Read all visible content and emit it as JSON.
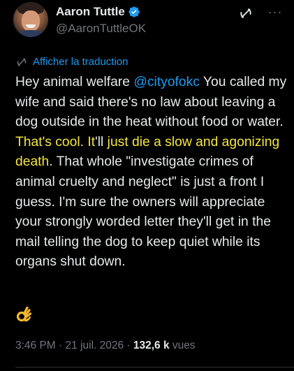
{
  "author": {
    "display_name": "Aaron Tuttle",
    "handle": "@AaronTuttleOK",
    "verified_color": "#1d9bf0"
  },
  "actions": {
    "grok_icon": "grok-icon",
    "more_icon": "more-icon",
    "more_label": "···"
  },
  "translate": {
    "label": "Afficher la traduction",
    "icon": "translate-icon"
  },
  "tweet": {
    "seg1": "Hey animal welfare ",
    "mention": "@cityofokc",
    "seg2": " You called my wife and said there's no law about leaving a dog outside in the heat without food or water. ",
    "hl1": "That's cool. It",
    "seg3": "'ll ",
    "hl2": "just die a slow and agonizing death",
    "seg4": ". That whole \"investigate crimes of animal cruelty and neglect\" is just a front I guess. I'm sure the owners will appreciate your strongly worded letter they'll get in the mail telling the dog to keep quiet while its organs shut down.",
    "emoji": "ok-hand-emoji"
  },
  "meta": {
    "time": "3:46 PM",
    "separator1": " · ",
    "date": "21 juil. 2026",
    "separator2": " · ",
    "views_count": "132,6 k",
    "views_label": " vues"
  },
  "colors": {
    "background": "#000000",
    "text": "#e7e9ea",
    "secondary": "#71767b",
    "link": "#1d9bf0",
    "highlight": "#f5e63c"
  }
}
